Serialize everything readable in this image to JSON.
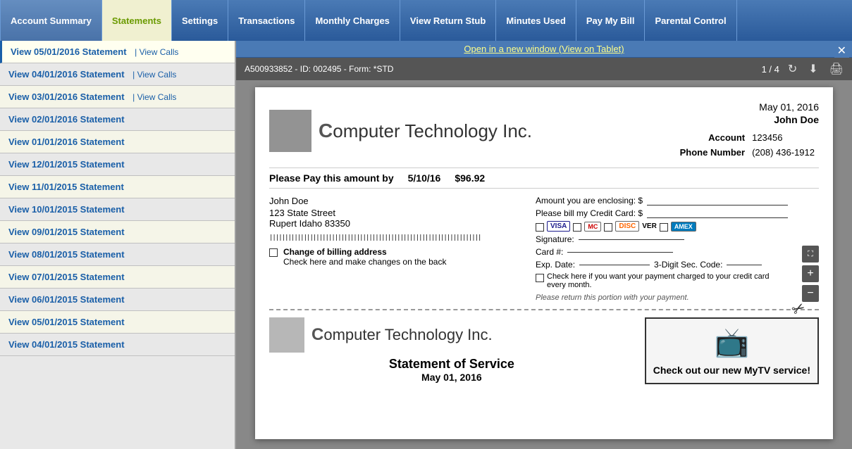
{
  "nav": {
    "tabs": [
      {
        "id": "account-summary",
        "label": "Account Summary",
        "active": false
      },
      {
        "id": "statements",
        "label": "Statements",
        "active": true
      },
      {
        "id": "settings",
        "label": "Settings",
        "active": false
      },
      {
        "id": "transactions",
        "label": "Transactions",
        "active": false
      },
      {
        "id": "monthly-charges",
        "label": "Monthly Charges",
        "active": false
      },
      {
        "id": "view-return-stub",
        "label": "View Return Stub",
        "active": false
      },
      {
        "id": "minutes-used",
        "label": "Minutes Used",
        "active": false
      },
      {
        "id": "pay-my-bill",
        "label": "Pay My Bill",
        "active": false
      },
      {
        "id": "parental-control",
        "label": "Parental Control",
        "active": false
      }
    ]
  },
  "statements": {
    "items": [
      {
        "date": "05/01/2016",
        "selected": true,
        "show_calls": true
      },
      {
        "date": "04/01/2016",
        "selected": false,
        "show_calls": true
      },
      {
        "date": "03/01/2016",
        "selected": false,
        "show_calls": true
      },
      {
        "date": "02/01/2016",
        "selected": false,
        "show_calls": false
      },
      {
        "date": "01/01/2016",
        "selected": false,
        "show_calls": false
      },
      {
        "date": "12/01/2015",
        "selected": false,
        "show_calls": false
      },
      {
        "date": "11/01/2015",
        "selected": false,
        "show_calls": false
      },
      {
        "date": "10/01/2015",
        "selected": false,
        "show_calls": false
      },
      {
        "date": "09/01/2015",
        "selected": false,
        "show_calls": false
      },
      {
        "date": "08/01/2015",
        "selected": false,
        "show_calls": false
      },
      {
        "date": "07/01/2015",
        "selected": false,
        "show_calls": false
      },
      {
        "date": "06/01/2015",
        "selected": false,
        "show_calls": false
      },
      {
        "date": "05/01/2015",
        "selected": false,
        "show_calls": false
      },
      {
        "date": "04/01/2015",
        "selected": false,
        "show_calls": false
      }
    ],
    "view_prefix": "View ",
    "stmt_suffix": " Statement",
    "view_calls_label": "| View Calls"
  },
  "pdf": {
    "open_link": "Open in a new window (View on Tablet)",
    "doc_id": "A500933852 - ID: 002495 - Form: *STD",
    "page_info": "1 / 4",
    "bill": {
      "company_name": "omputer Technology Inc.",
      "date": "May 01, 2016",
      "customer_name": "John Doe",
      "account_label": "Account",
      "account_number": "123456",
      "phone_label": "Phone Number",
      "phone_number": "(208) 436-1912",
      "pay_by_label": "Please Pay this amount by",
      "pay_by_date": "5/10/16",
      "pay_by_amount": "$96.92",
      "enclosing_label": "Amount you are enclosing:  $",
      "credit_label": "Please bill my Credit Card:  $",
      "signature_label": "Signature:",
      "card_label": "Card #:",
      "exp_date_label": "Exp. Date:",
      "sec_code_label": "3-Digit Sec. Code:",
      "monthly_charge_label": "Check here if you want your payment charged to your credit card every month.",
      "return_label": "Please return this portion with your payment.",
      "address": {
        "name": "John Doe",
        "street": "123 State Street",
        "city": "Rupert Idaho 83350"
      },
      "change_address_label": "Change of billing address",
      "change_address_sub": "Check here and make changes on the back",
      "stmt_service_label": "Statement of Service",
      "stmt_date": "May 01, 2016",
      "mytv_label": "Check out our new MyTV service!"
    }
  },
  "colors": {
    "nav_bg": "#3a6aa0",
    "active_tab_bg": "#f0f0d0",
    "active_tab_color": "#6a9a00"
  }
}
